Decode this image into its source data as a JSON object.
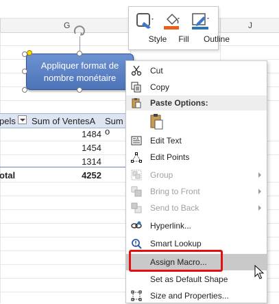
{
  "spreadsheet": {
    "columns": [
      "G",
      "J"
    ],
    "pivot": {
      "header": {
        "label_col": "pels",
        "sum_col": "Sum of VentesA",
        "sum_col2": "Sum o"
      },
      "rows": [
        {
          "value": "1484"
        },
        {
          "value": "1454"
        },
        {
          "value": "1314"
        }
      ],
      "total": {
        "label": "otal",
        "value": "4252"
      }
    }
  },
  "shape": {
    "text": "Appliquer format de nombre monétaire",
    "fill_color": "#5b7fc4"
  },
  "mini_toolbar": {
    "items": [
      {
        "label": "Style",
        "icon": "shape-style-icon"
      },
      {
        "label": "Fill",
        "icon": "paint-bucket-icon"
      },
      {
        "label": "Outline",
        "icon": "pen-outline-icon"
      }
    ],
    "accent_fill": "#e8601c",
    "accent_outline": "#2e75b6"
  },
  "context_menu": {
    "items": {
      "cut": "Cut",
      "copy": "Copy",
      "paste_options": "Paste Options:",
      "edit_text": "Edit Text",
      "edit_points": "Edit Points",
      "group": "Group",
      "bring_to_front": "Bring to Front",
      "send_to_back": "Send to Back",
      "hyperlink": "Hyperlink...",
      "smart_lookup": "Smart Lookup",
      "assign_macro": "Assign Macro...",
      "set_default_shape": "Set as Default Shape",
      "size_properties": "Size and Properties..."
    },
    "highlight_color": "#c9c9c9",
    "callout_color": "#e01010"
  }
}
